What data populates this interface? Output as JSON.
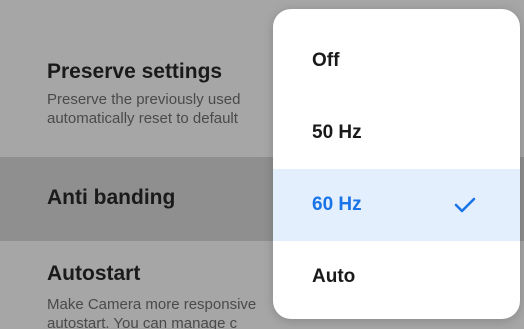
{
  "settings": {
    "preserve": {
      "title": "Preserve settings",
      "desc_line1": "Preserve the previously used",
      "desc_line2": "automatically reset to default"
    },
    "antibanding": {
      "title": "Anti banding"
    },
    "autostart": {
      "title": "Autostart",
      "desc_line1": "Make Camera more responsive",
      "desc_line2": "autostart. You can manage c"
    }
  },
  "menu": {
    "options": [
      {
        "label": "Off",
        "selected": false
      },
      {
        "label": "50 Hz",
        "selected": false
      },
      {
        "label": "60 Hz",
        "selected": true
      },
      {
        "label": "Auto",
        "selected": false
      }
    ],
    "check_icon": "checkmark-icon",
    "accent_color": "#1a74e8",
    "selected_bg": "#e3effd"
  }
}
